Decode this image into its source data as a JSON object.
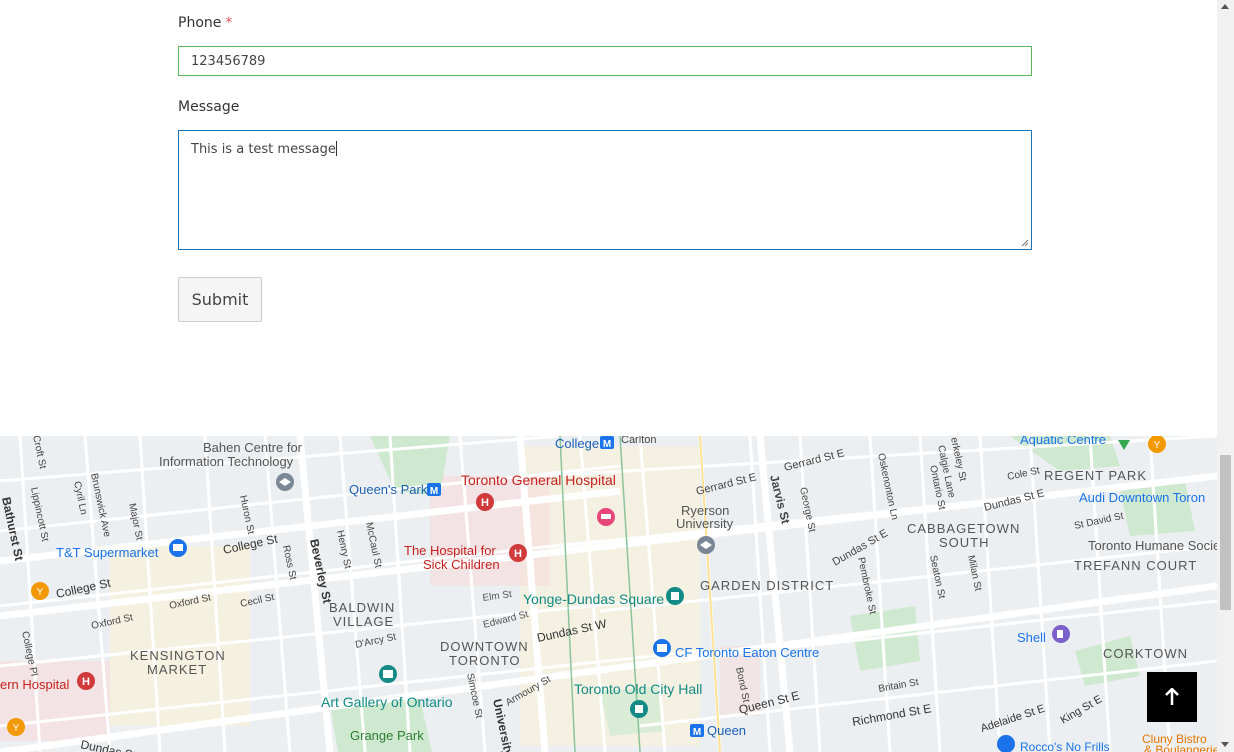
{
  "form": {
    "phone_label": "Phone",
    "required_mark": "*",
    "phone_value": "123456789",
    "message_label": "Message",
    "message_value": "This is a test message",
    "submit_label": "Submit"
  },
  "map": {
    "labels": {
      "bahen": "Bahen Centre for",
      "bahen2": "Information Technology",
      "college_station": "College",
      "carlton": "Carlton",
      "queens_park": "Queen's Park",
      "tgh": "Toronto General Hospital",
      "gerrard_e": "Gerrard St E",
      "gerrard_e2": "Gerrard St E",
      "jarvis": "Jarvis St",
      "dundas_e": "Dundas St E",
      "dundas_e2": "Dundas St E",
      "aquatic": "Aquatic Centre",
      "regent_park": "REGENT PARK",
      "audi": "Audi Downtown Toron",
      "cabbagetown": "CABBAGETOWN",
      "south": "SOUTH",
      "humane": "Toronto Humane Society",
      "trefann": "TREFANN COURT",
      "ryerson": "Ryerson",
      "ryerson2": "University",
      "college_st": "College St",
      "college_st2": "College St",
      "beverley": "Beverley St",
      "sickkids": "The Hospital for",
      "sickkids2": "Sick Children",
      "tt": "T&T Supermarket",
      "baldwin": "BALDWIN",
      "village": "VILLAGE",
      "garden": "GARDEN DISTRICT",
      "yonge_dundas": "Yonge-Dundas Square",
      "dundas_w": "Dundas St W",
      "dundas_w2": "Dundas St W",
      "edward": "Edward St",
      "elm": "Elm St",
      "kensington": "KENSINGTON",
      "market": "MARKET",
      "downtown": "DOWNTOWN",
      "toronto": "TORONTO",
      "eaton": "CF Toronto Eaton Centre",
      "shell": "Shell",
      "corktown": "CORKTOWN",
      "ago": "Art Gallery of Ontario",
      "city_hall": "Toronto Old City Hall",
      "queen_station": "Queen",
      "queen_e": "Queen St E",
      "richmond": "Richmond St E",
      "adelaide": "Adelaide St E",
      "king": "King St E",
      "grange": "Grange Park",
      "rocco": "Rocco's No Frills",
      "cluny": "Cluny Bistro",
      "cluny2": "& Boulangerie",
      "western": "ern Hospital",
      "bathurst": "Bathurst St",
      "oxford": "Oxford St",
      "oxford2": "Oxford St",
      "university": "University",
      "armoury": "Armoury St",
      "simcoe": "Simcoe St",
      "bond": "Bond St",
      "britain": "Britain St",
      "cole": "Cole St",
      "st_david": "St David St",
      "pembroke": "Pembroke St",
      "seaton": "Seaton St",
      "milan": "Milan St",
      "huron": "Huron St",
      "ross": "Ross St",
      "henry": "Henry St",
      "mccaul": "McCaul St",
      "darcy": "D'Arcy St",
      "cecil": "Cecil St",
      "major": "Major St",
      "brunswick": "Brunswick Ave",
      "croft": "Croft St",
      "cyril": "Cyril Ln",
      "lippincott": "Lippincott St",
      "college_pl": "College Pl",
      "george": "George St",
      "ontario": "Ontario St",
      "oskenonton": "Oskenonton Ln",
      "calgie": "Calgie Lane",
      "berkeley": "erkeley St"
    }
  },
  "colors": {
    "input_border_valid": "#5cb85c",
    "textarea_border_focus": "#1a73b8",
    "map_hospital": "#d03a3a",
    "map_transit": "#1a73e8",
    "map_attraction": "#138a86",
    "map_food": "#f29900"
  },
  "icons": {
    "back_to_top": "arrow-up-icon"
  }
}
